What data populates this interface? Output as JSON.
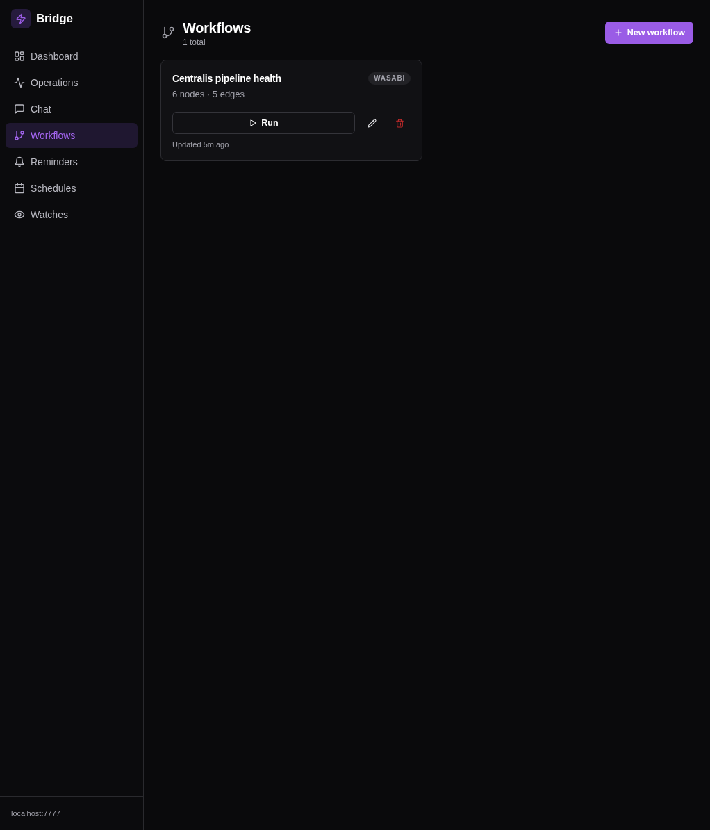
{
  "sidebar": {
    "brand": "Bridge",
    "items": [
      {
        "label": "Dashboard",
        "selected": false
      },
      {
        "label": "Operations",
        "selected": false
      },
      {
        "label": "Chat",
        "selected": false
      },
      {
        "label": "Workflows",
        "selected": true
      },
      {
        "label": "Reminders",
        "selected": false
      },
      {
        "label": "Schedules",
        "selected": false
      },
      {
        "label": "Watches",
        "selected": false
      }
    ],
    "footer": "localhost:7777"
  },
  "header": {
    "title": "Workflows",
    "subtitle": "1 total",
    "new_button": "New workflow"
  },
  "workflows": [
    {
      "name": "Centralis pipeline health",
      "tag": "WASABI",
      "summary": "6 nodes · 5 edges",
      "run_label": "Run",
      "updated": "Updated 5m ago"
    }
  ]
}
